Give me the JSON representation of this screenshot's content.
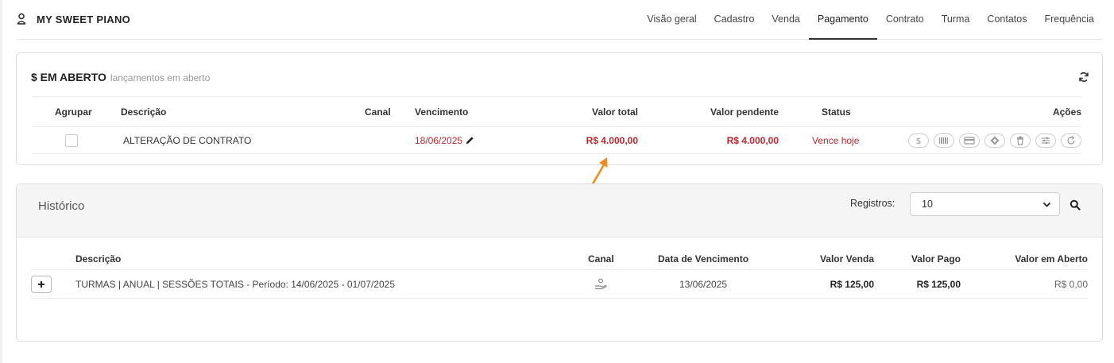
{
  "header": {
    "title": "MY SWEET PIANO",
    "tabs": [
      {
        "label": "Visão geral"
      },
      {
        "label": "Cadastro"
      },
      {
        "label": "Venda"
      },
      {
        "label": "Pagamento",
        "active": true
      },
      {
        "label": "Contrato"
      },
      {
        "label": "Turma"
      },
      {
        "label": "Contatos"
      },
      {
        "label": "Frequência"
      }
    ]
  },
  "open": {
    "title": "$ EM ABERTO",
    "subtitle": "lançamentos em aberto",
    "columns": {
      "group": "Agrupar",
      "description": "Descrição",
      "channel": "Canal",
      "due": "Vencimento",
      "total": "Valor total",
      "pending": "Valor pendente",
      "status": "Status",
      "actions": "Ações"
    },
    "rows": [
      {
        "description": "ALTERAÇÃO DE CONTRATO",
        "channel": "",
        "due": "18/06/2025",
        "total": "R$ 4.000,00",
        "pending": "R$ 4.000,00",
        "status": "Vence hoje"
      }
    ],
    "actions": [
      "dollar-icon",
      "barcode-icon",
      "card-icon",
      "pix-icon",
      "trash-icon",
      "sliders-icon",
      "redo-icon"
    ]
  },
  "history": {
    "title": "Histórico",
    "records_label": "Registros:",
    "records_value": "10",
    "columns": {
      "description": "Descrição",
      "channel": "Canal",
      "due": "Data de Vencimento",
      "sale": "Valor Venda",
      "paid": "Valor Pago",
      "open": "Valor em Aberto"
    },
    "rows": [
      {
        "description": "TURMAS | ANUAL | SESSÕES TOTAIS - Período: 14/06/2025 - 01/07/2025",
        "channel_icon": "hand-coin-icon",
        "due": "13/06/2025",
        "sale": "R$ 125,00",
        "paid": "R$ 125,00",
        "open": "R$ 0,00"
      }
    ]
  },
  "colors": {
    "accent_red": "#c0262d",
    "annotation_orange": "#f28c1a"
  }
}
